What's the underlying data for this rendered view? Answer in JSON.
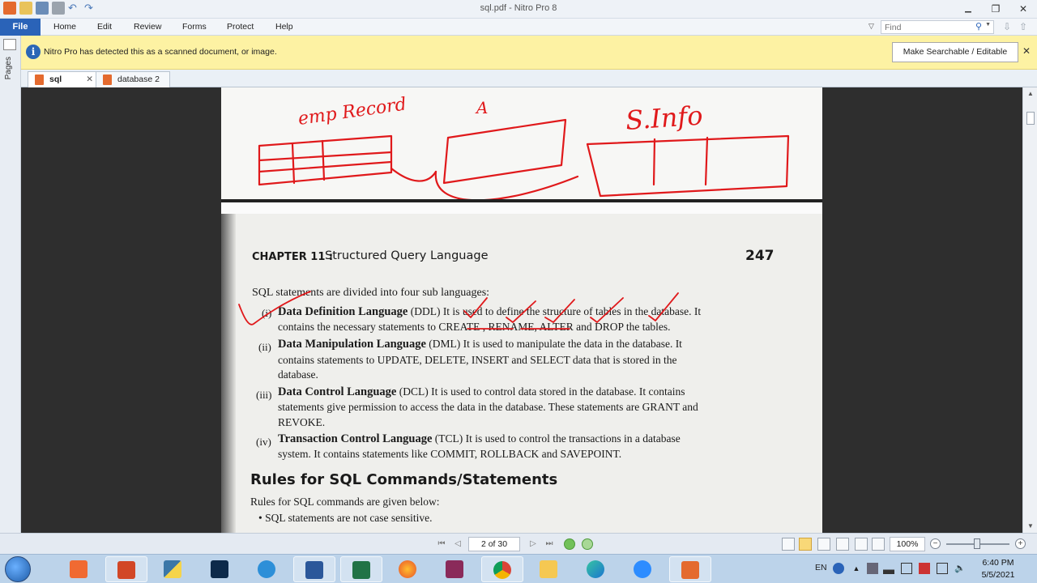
{
  "window": {
    "title": "sql.pdf - Nitro Pro 8",
    "minimize": "▭",
    "restore": "❐",
    "close": "✕"
  },
  "menu": {
    "file": "File",
    "items": [
      "Home",
      "Edit",
      "Review",
      "Forms",
      "Protect",
      "Help"
    ],
    "find_placeholder": "Find"
  },
  "notification": {
    "text": "Nitro Pro has detected this as a scanned document, or image.",
    "button": "Make Searchable / Editable",
    "close": "✕",
    "icon": "info-icon"
  },
  "side_panel": {
    "label": "Pages"
  },
  "tabs": [
    {
      "label": "sql",
      "active": true,
      "close": "✕"
    },
    {
      "label": "database 2",
      "active": false
    }
  ],
  "document": {
    "annotations": {
      "text1": "emp Record",
      "text2": "A",
      "text3": "S.Info"
    },
    "chapter_label": "CHAPTER 11 :",
    "chapter_title": "Structured Query Language",
    "page_number": "247",
    "intro": "SQL statements are divided into four sub languages:",
    "items": [
      {
        "num": "(i)",
        "head": "Data Definition Language",
        "line1": "(DDL)  It is used to define the structure of tables in the database. It",
        "line2": "contains the necessary statements to CREATE , RENAME, ALTER and DROP the tables."
      },
      {
        "num": "(ii)",
        "head": "Data Manipulation Language",
        "line1": "(DML)  It is used to manipulate the data in the database. It",
        "line2": "contains statements to UPDATE, DELETE, INSERT and SELECT data that is stored in the",
        "line3": "database."
      },
      {
        "num": "(iii)",
        "head": "Data Control Language",
        "line1": "(DCL)  It is used to control data stored in the database. It contains",
        "line2": "statements give permission to access the data in the database. These statements are GRANT and",
        "line3": "REVOKE."
      },
      {
        "num": "(iv)",
        "head": "Transaction Control Language",
        "line1": "(TCL)    It is used to control the transactions in a database",
        "line2": "system. It contains statements like COMMIT, ROLLBACK and SAVEPOINT."
      }
    ],
    "rules_heading": "Rules for SQL Commands/Statements",
    "rules_intro": "Rules for SQL commands are given below:",
    "rule_1": "• SQL statements are not case sensitive."
  },
  "status": {
    "page_indicator": "2 of 30",
    "zoom": "100%",
    "zoom_minus": "−",
    "zoom_plus": "+"
  },
  "taskbar": {
    "lang": "EN",
    "time": "6:40 PM",
    "date": "5/5/2021",
    "apps": [
      "brave",
      "powerpoint",
      "python",
      "photoshop",
      "internet-explorer",
      "word",
      "excel",
      "firefox",
      "winrar",
      "chrome",
      "file-explorer",
      "edge",
      "zoom",
      "nitro-pro"
    ]
  },
  "colors": {
    "accent": "#2a63b8",
    "notification_bg": "#fdf2a3",
    "annotation_red": "#e0191b",
    "doc_background": "#2e2e2e"
  }
}
